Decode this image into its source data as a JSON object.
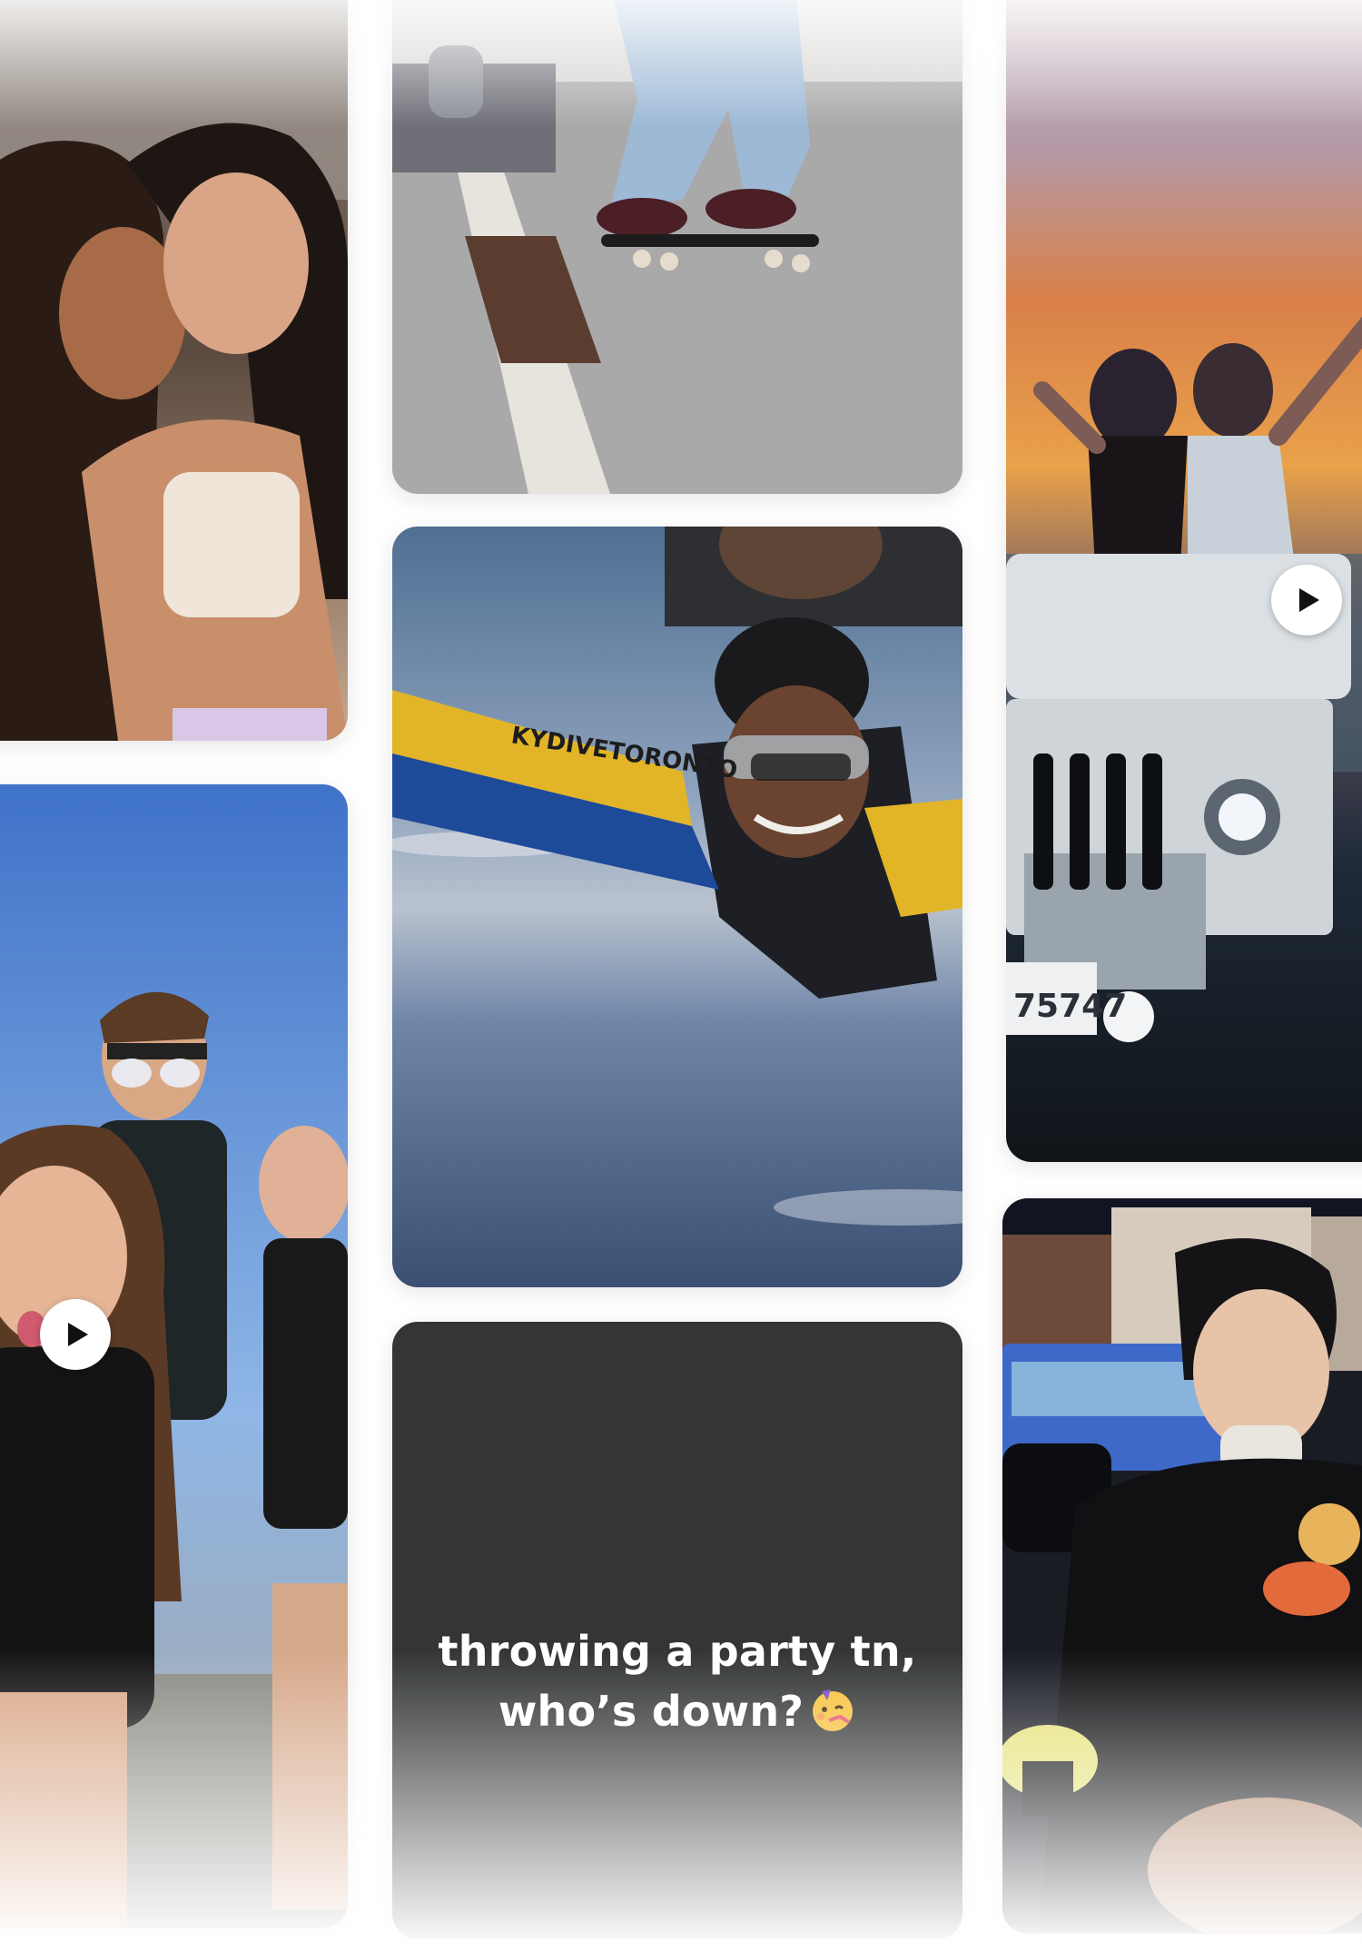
{
  "feed": {
    "posts": [
      {
        "id": "friends-selfie",
        "type": "photo",
        "video": false
      },
      {
        "id": "group-selfie",
        "type": "video",
        "video": true
      },
      {
        "id": "skateboard-trick",
        "type": "photo",
        "video": false
      },
      {
        "id": "skydive",
        "type": "photo",
        "video": false,
        "visible_text": "KYDIVETORONTO"
      },
      {
        "id": "text-post",
        "type": "text",
        "video": false,
        "text_lines": [
          "throwing a party tn,",
          "who’s down?"
        ],
        "emoji": "party-face"
      },
      {
        "id": "sunset-jeep",
        "type": "video",
        "video": true,
        "visible_text": "75747"
      },
      {
        "id": "night-dessert",
        "type": "photo",
        "video": false
      }
    ]
  },
  "colors": {
    "text_post_background": "#333635",
    "text_post_foreground": "#ffffff",
    "page_background": "#ffffff"
  },
  "icons": {
    "play": "play-icon",
    "party": "party-face-emoji"
  }
}
